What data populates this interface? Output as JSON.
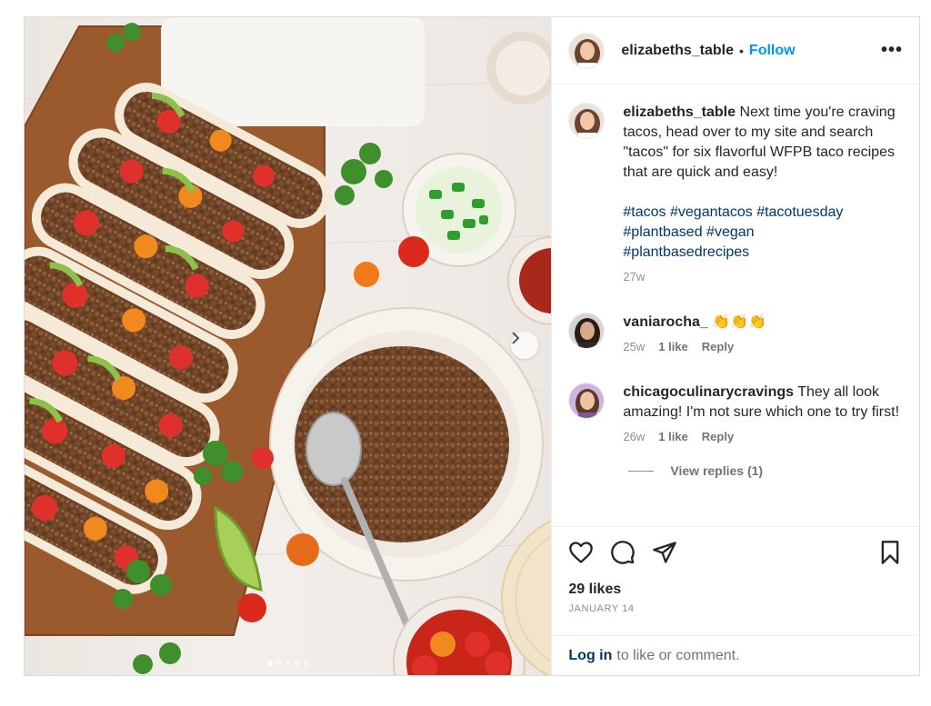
{
  "post": {
    "author": {
      "username": "elizabeths_table",
      "separator": "•",
      "follow_label": "Follow",
      "more_icon": "more-horizontal-icon"
    },
    "caption": {
      "username": "elizabeths_table",
      "text": "Next time you're craving tacos, head over to my site and search \"tacos\" for six flavorful WFPB taco recipes that are quick and easy!",
      "hashtags": [
        "#tacos",
        "#vegantacos",
        "#tacotuesday",
        "#plantbased",
        "#vegan",
        "#plantbasedrecipes"
      ],
      "age": "27w"
    },
    "comments": [
      {
        "username": "vaniarocha_",
        "text": "👏👏👏",
        "age": "25w",
        "likes": "1 like",
        "reply_label": "Reply"
      },
      {
        "username": "chicagoculinarycravings",
        "text": "They all look amazing! I'm not sure which one to try first!",
        "age": "26w",
        "likes": "1 like",
        "reply_label": "Reply",
        "view_replies": "View replies (1)"
      }
    ],
    "likes": "29 likes",
    "date": "JANUARY 14",
    "login": {
      "link": "Log in",
      "rest": "to like or comment."
    },
    "carousel": {
      "total": 5,
      "active": 0
    },
    "colors": {
      "accent": "#0095f6",
      "hashtag": "#00376b",
      "muted": "#8e8e8e"
    }
  }
}
